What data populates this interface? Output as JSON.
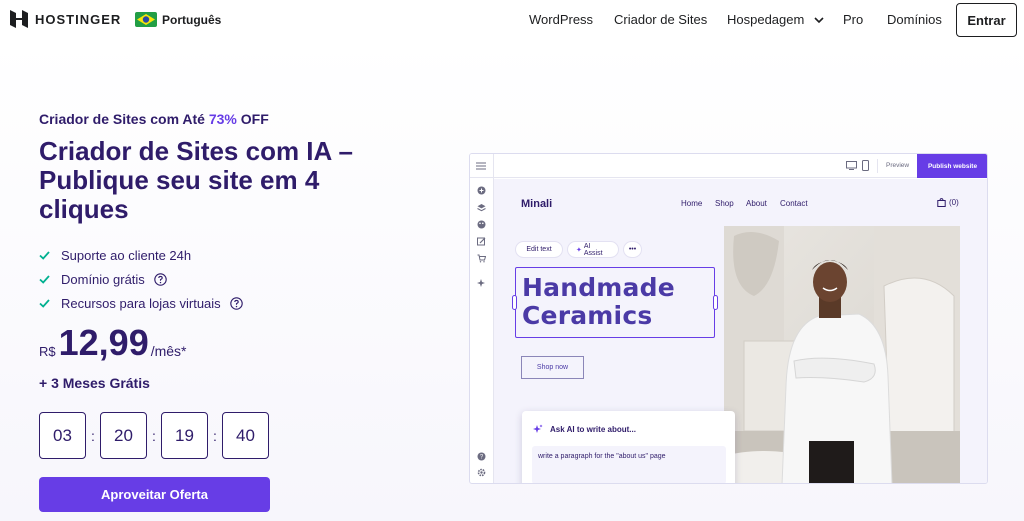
{
  "header": {
    "brand": "HOSTINGER",
    "language": "Português",
    "nav": [
      "WordPress",
      "Criador de Sites",
      "Hospedagem",
      "Pro",
      "Domínios"
    ],
    "login_label": "Entrar"
  },
  "hero": {
    "kicker_prefix": "Criador de Sites com Até ",
    "kicker_discount": "73%",
    "kicker_suffix": " OFF",
    "headline": "Criador de Sites com IA – Publique seu site em 4 cliques",
    "features": [
      "Suporte ao cliente 24h",
      "Domínio grátis",
      "Recursos para lojas virtuais"
    ],
    "price_currency": "R$",
    "price_value": "12,99",
    "price_period": "/mês*",
    "bonus": "+ 3 Meses Grátis",
    "countdown": [
      "03",
      "20",
      "19",
      "40"
    ],
    "cta_label": "Aproveitar Oferta"
  },
  "builder": {
    "preview_label": "Preview",
    "publish_label": "Publish website",
    "site_brand": "Minali",
    "site_nav": [
      "Home",
      "Shop",
      "About",
      "Contact"
    ],
    "cart_label": "(0)",
    "toolbar": {
      "edit_text": "Edit text",
      "ai_assist": "AI Assist",
      "more": "•••"
    },
    "title_line1": "Handmade",
    "title_line2": "Ceramics",
    "shop_now": "Shop now",
    "ai_card": {
      "title": "Ask AI to write about...",
      "prompt": "write a paragraph for the \"about us\" page"
    }
  },
  "colors": {
    "primary": "#673de6",
    "dark": "#2f1c6a",
    "check": "#00b090"
  },
  "icons": [
    "hostinger-logo-icon",
    "brazil-flag-icon",
    "chevron-down-icon",
    "check-icon",
    "help-icon",
    "menu-icon",
    "desktop-icon",
    "mobile-icon",
    "sparkle-icon",
    "cart-icon"
  ]
}
